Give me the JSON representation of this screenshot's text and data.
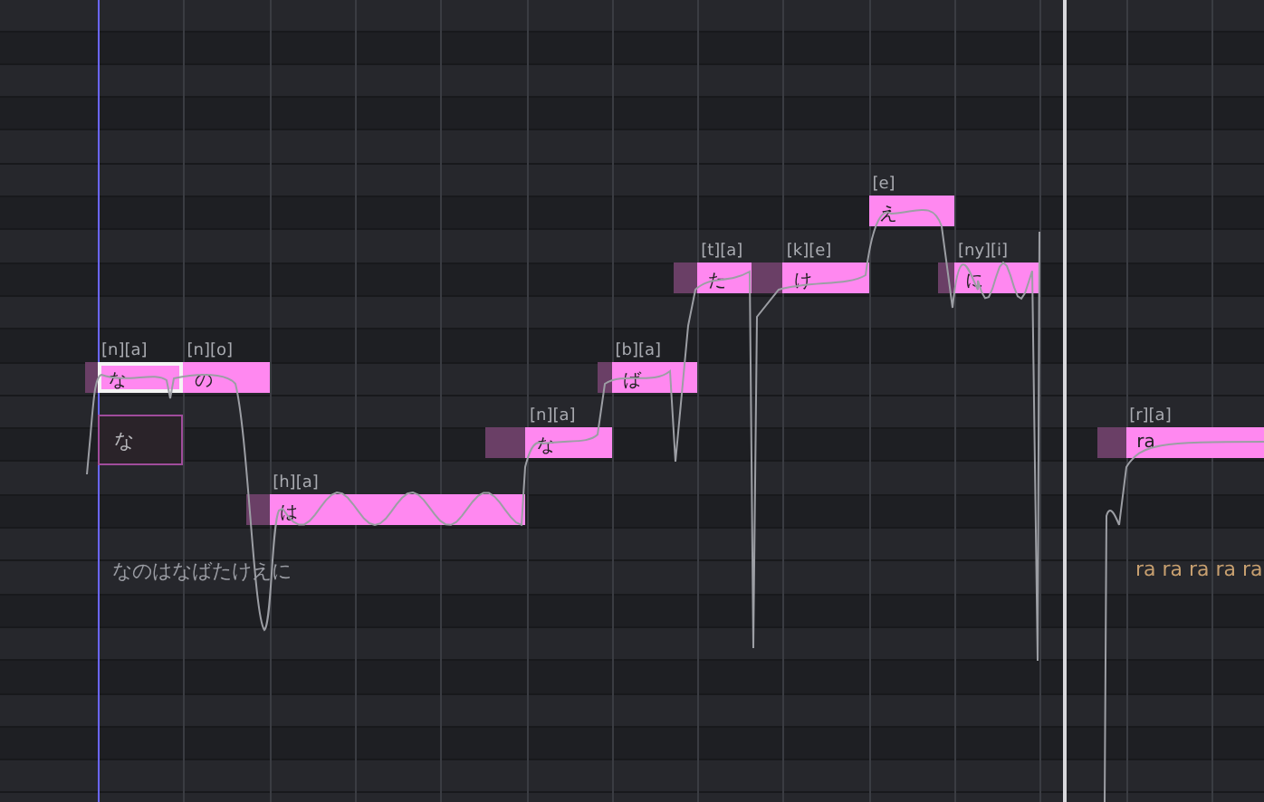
{
  "notes": [
    {
      "lyric": "な",
      "phonemes": "[n][a]",
      "selected": true
    },
    {
      "lyric": "の",
      "phonemes": "[n][o]",
      "selected": false
    },
    {
      "lyric": "は",
      "phonemes": "[h][a]",
      "selected": false
    },
    {
      "lyric": "な",
      "phonemes": "[n][a]",
      "selected": false
    },
    {
      "lyric": "ば",
      "phonemes": "[b][a]",
      "selected": false
    },
    {
      "lyric": "た",
      "phonemes": "[t][a]",
      "selected": false
    },
    {
      "lyric": "け",
      "phonemes": "[k][e]",
      "selected": false
    },
    {
      "lyric": "え",
      "phonemes": "[e]",
      "selected": false
    },
    {
      "lyric": "に",
      "phonemes": "[ny][i]",
      "selected": false
    },
    {
      "lyric": "ra",
      "phonemes": "[r][a]",
      "selected": false
    }
  ],
  "lyric_editor": {
    "value": "な"
  },
  "phrase_lyrics": [
    {
      "text": "なのはなばたけえに",
      "color": "#9a9ca3"
    },
    {
      "text": "ra ra ra ra ra",
      "color": "#c8a070"
    }
  ]
}
